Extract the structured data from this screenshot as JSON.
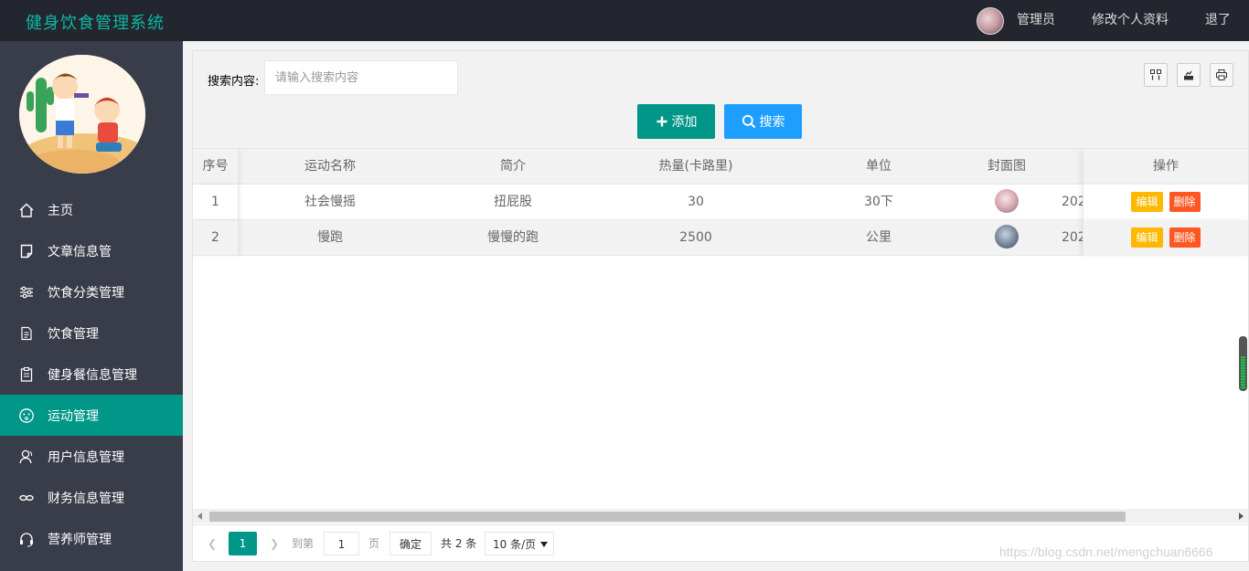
{
  "header": {
    "title": "健身饮食管理系统",
    "user_label": "管理员",
    "edit_profile": "修改个人资料",
    "logout": "退了"
  },
  "sidebar": {
    "items": [
      {
        "label": "主页",
        "icon": "home-icon"
      },
      {
        "label": "文章信息管",
        "icon": "note-icon"
      },
      {
        "label": "饮食分类管理",
        "icon": "sliders-icon"
      },
      {
        "label": "饮食管理",
        "icon": "document-icon"
      },
      {
        "label": "健身餐信息管理",
        "icon": "clipboard-icon"
      },
      {
        "label": "运动管理",
        "icon": "face-icon",
        "active": true
      },
      {
        "label": "用户信息管理",
        "icon": "user-icon"
      },
      {
        "label": "财务信息管理",
        "icon": "link-icon"
      },
      {
        "label": "营养师管理",
        "icon": "headset-icon"
      }
    ]
  },
  "toolbar": {
    "search_label": "搜索内容:",
    "search_placeholder": "请输入搜索内容",
    "add_label": "添加",
    "search_button": "搜索"
  },
  "table": {
    "headers": [
      "序号",
      "运动名称",
      "简介",
      "热量(卡路里)",
      "单位",
      "封面图",
      "操作"
    ],
    "rows": [
      {
        "idx": "1",
        "name": "社会慢摇",
        "desc": "扭屁股",
        "cal": "30",
        "unit": "30下",
        "date": "202"
      },
      {
        "idx": "2",
        "name": "慢跑",
        "desc": "慢慢的跑",
        "cal": "2500",
        "unit": "公里",
        "date": "202"
      }
    ],
    "edit_label": "编辑",
    "delete_label": "删除"
  },
  "pager": {
    "current": "1",
    "goto_label": "到第",
    "page_input": "1",
    "page_label": "页",
    "confirm_label": "确定",
    "total_label": "共 2 条",
    "per_page": "10 条/页"
  },
  "watermark": "https://blog.csdn.net/mengchuan6666",
  "colors": {
    "header_bg": "#23262e",
    "sidebar_bg": "#393d49",
    "accent": "#009688",
    "search_button": "#1e9fff",
    "edit_button": "#ffb800",
    "delete_button": "#ff5722",
    "logo_text": "#0bb9a4"
  }
}
